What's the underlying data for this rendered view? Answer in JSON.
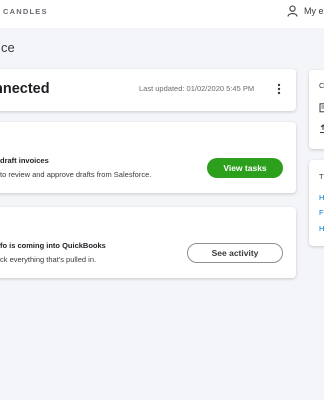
{
  "header": {
    "brand": "CANDLES",
    "account_label": "My ex"
  },
  "page": {
    "title": "ce"
  },
  "status_card": {
    "status": "nnected",
    "last_updated": "Last updated: 01/02/2020 5:45 PM"
  },
  "tasks_card": {
    "title": "draft invoices",
    "description": "to review and approve drafts from Salesforce.",
    "button": "View tasks"
  },
  "activity_card": {
    "title": "fo is coming into QuickBooks",
    "description": "ck everything that's pulled in.",
    "button": "See activity"
  },
  "side_panel_1": {
    "heading_letter": "C"
  },
  "side_panel_2": {
    "heading_letter": "T",
    "links": [
      "H",
      "F",
      "H"
    ]
  },
  "colors": {
    "primary_button": "#2ca01c",
    "link": "#0077c5",
    "page_background": "#f4f5f8"
  }
}
